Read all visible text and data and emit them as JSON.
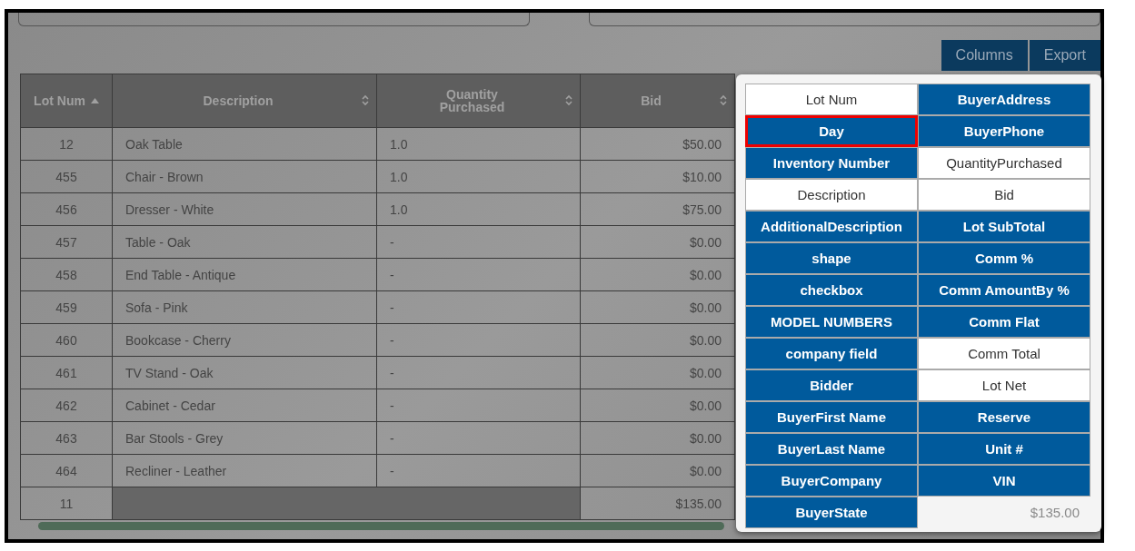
{
  "toolbar": {
    "buttons": [
      "Columns",
      "Export"
    ]
  },
  "table": {
    "columns": [
      {
        "label": "Lot Num",
        "sorted": true
      },
      {
        "label": "Description",
        "sorted": false
      },
      {
        "label": "Quantity Purchased",
        "sorted": false
      },
      {
        "label": "Bid",
        "sorted": false
      }
    ],
    "rows": [
      [
        "12",
        "Oak Table",
        "1.0",
        "$50.00"
      ],
      [
        "455",
        "Chair - Brown",
        "1.0",
        "$10.00"
      ],
      [
        "456",
        "Dresser - White",
        "1.0",
        "$75.00"
      ],
      [
        "457",
        "Table - Oak",
        "-",
        "$0.00"
      ],
      [
        "458",
        "End Table - Antique",
        "-",
        "$0.00"
      ],
      [
        "459",
        "Sofa - Pink",
        "-",
        "$0.00"
      ],
      [
        "460",
        "Bookcase - Cherry",
        "-",
        "$0.00"
      ],
      [
        "461",
        "TV Stand - Oak",
        "-",
        "$0.00"
      ],
      [
        "462",
        "Cabinet - Cedar",
        "-",
        "$0.00"
      ],
      [
        "463",
        "Bar Stools - Grey",
        "-",
        "$0.00"
      ],
      [
        "464",
        "Recliner - Leather",
        "-",
        "$0.00"
      ]
    ],
    "footer": {
      "count": "11",
      "bid_total": "$135.00"
    },
    "hidden_total": "$135.00"
  },
  "column_picker": {
    "items": [
      {
        "label": "Lot Num",
        "selected": true,
        "highlighted": false
      },
      {
        "label": "Day",
        "selected": false,
        "highlighted": true
      },
      {
        "label": "Inventory Number",
        "selected": false,
        "highlighted": false
      },
      {
        "label": "Description",
        "selected": true,
        "highlighted": false
      },
      {
        "label": "AdditionalDescription",
        "selected": false,
        "highlighted": false
      },
      {
        "label": "shape",
        "selected": false,
        "highlighted": false
      },
      {
        "label": "checkbox",
        "selected": false,
        "highlighted": false
      },
      {
        "label": "MODEL NUMBERS",
        "selected": false,
        "highlighted": false
      },
      {
        "label": "company field",
        "selected": false,
        "highlighted": false
      },
      {
        "label": "Bidder",
        "selected": false,
        "highlighted": false
      },
      {
        "label": "BuyerFirst Name",
        "selected": false,
        "highlighted": false
      },
      {
        "label": "BuyerLast Name",
        "selected": false,
        "highlighted": false
      },
      {
        "label": "BuyerCompany",
        "selected": false,
        "highlighted": false
      },
      {
        "label": "BuyerState",
        "selected": false,
        "highlighted": false
      },
      {
        "label": "BuyerAddress",
        "selected": false,
        "highlighted": false
      },
      {
        "label": "BuyerPhone",
        "selected": false,
        "highlighted": false
      },
      {
        "label": "QuantityPurchased",
        "selected": true,
        "highlighted": false
      },
      {
        "label": "Bid",
        "selected": true,
        "highlighted": false
      },
      {
        "label": "Lot SubTotal",
        "selected": false,
        "highlighted": false
      },
      {
        "label": "Comm %",
        "selected": false,
        "highlighted": false
      },
      {
        "label": "Comm AmountBy %",
        "selected": false,
        "highlighted": false
      },
      {
        "label": "Comm Flat",
        "selected": false,
        "highlighted": false
      },
      {
        "label": "Comm Total",
        "selected": true,
        "highlighted": false
      },
      {
        "label": "Lot Net",
        "selected": true,
        "highlighted": false
      },
      {
        "label": "Reserve",
        "selected": false,
        "highlighted": false
      },
      {
        "label": "Unit #",
        "selected": false,
        "highlighted": false
      },
      {
        "label": "VIN",
        "selected": false,
        "highlighted": false
      }
    ]
  }
}
